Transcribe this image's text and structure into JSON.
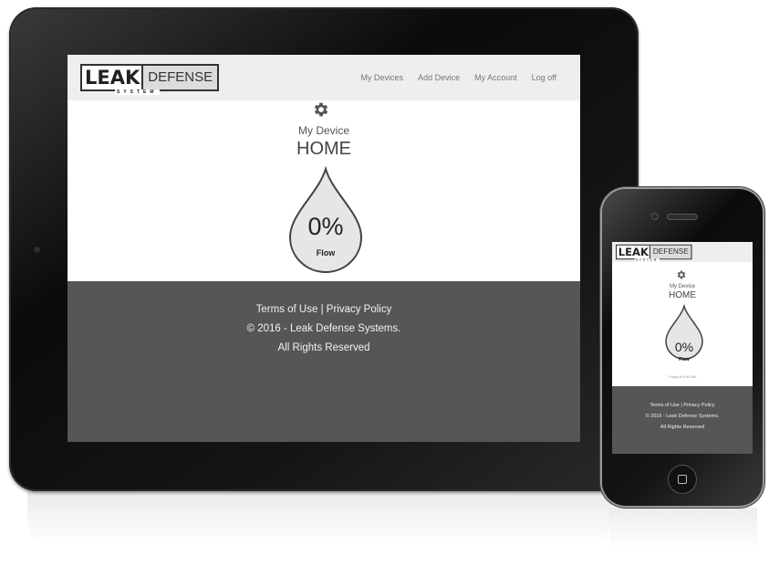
{
  "brand": {
    "leak": "LEAK",
    "defense": "DEFENSE",
    "system": "SYSTEM"
  },
  "nav": {
    "items": [
      {
        "label": "My Devices"
      },
      {
        "label": "Add Device"
      },
      {
        "label": "My Account"
      },
      {
        "label": "Log off"
      }
    ]
  },
  "device": {
    "name": "My Device",
    "location": "HOME",
    "flow_percent": "0%",
    "flow_label": "Flow",
    "updated": "Today at 8:56 AM"
  },
  "footer": {
    "terms": "Terms of Use",
    "separator": " | ",
    "privacy": "Privacy Policy",
    "copyright": "© 2016 - Leak Defense Systems.",
    "rights": "All Rights Reserved"
  },
  "icons": {
    "settings": "gear-icon",
    "drop": "water-drop-icon",
    "menu": "hamburger-menu-icon"
  },
  "colors": {
    "header_bg": "#eeeeee",
    "footer_bg": "#565656",
    "nav_text": "#777777"
  }
}
